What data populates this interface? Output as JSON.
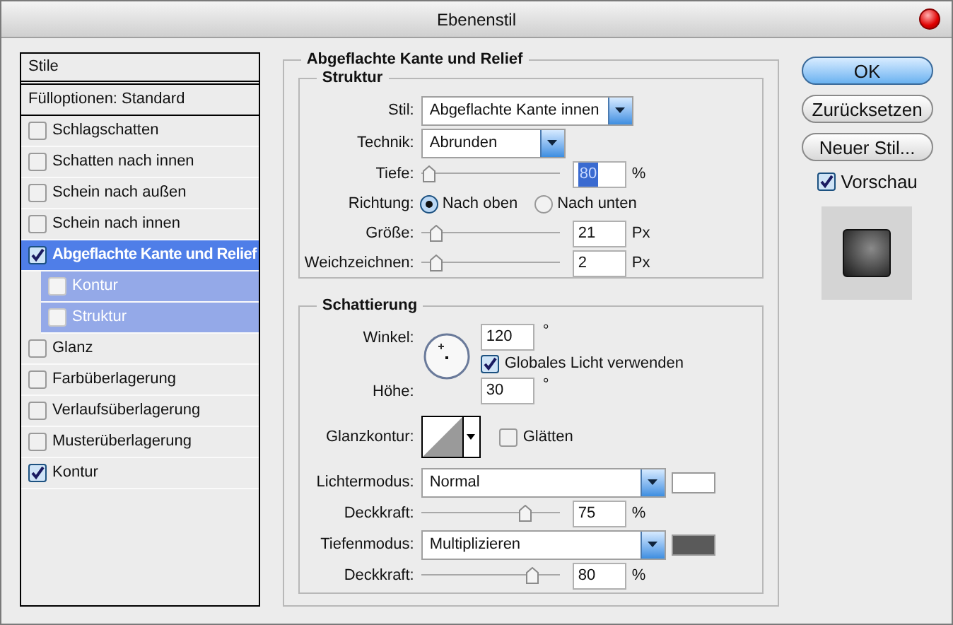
{
  "window": {
    "title": "Ebenenstil"
  },
  "sidebar": {
    "header": "Stile",
    "blending": "Fülloptionen: Standard",
    "items": [
      {
        "label": "Schlagschatten",
        "checked": false,
        "selected": false
      },
      {
        "label": "Schatten nach innen",
        "checked": false,
        "selected": false
      },
      {
        "label": "Schein nach außen",
        "checked": false,
        "selected": false
      },
      {
        "label": "Schein nach innen",
        "checked": false,
        "selected": false
      },
      {
        "label": "Abgeflachte Kante und Relief",
        "checked": true,
        "selected": true,
        "children": [
          {
            "label": "Kontur",
            "checked": false,
            "selected": true
          },
          {
            "label": "Struktur",
            "checked": false,
            "selected": true
          }
        ]
      },
      {
        "label": "Glanz",
        "checked": false,
        "selected": false
      },
      {
        "label": "Farbüberlagerung",
        "checked": false,
        "selected": false
      },
      {
        "label": "Verlaufsüberlagerung",
        "checked": false,
        "selected": false
      },
      {
        "label": "Musterüberlagerung",
        "checked": false,
        "selected": false
      },
      {
        "label": "Kontur",
        "checked": true,
        "selected": false
      }
    ]
  },
  "panel": {
    "title": "Abgeflachte Kante und Relief",
    "struktur": {
      "title": "Struktur",
      "rows": [
        {
          "kind": "select",
          "label": "Stil:",
          "value": "Abgeflachte Kante innen"
        },
        {
          "kind": "select",
          "label": "Technik:",
          "value": "Abrunden"
        },
        {
          "kind": "slider",
          "label": "Tiefe:",
          "level": 0.05,
          "value": "80",
          "unit": "%",
          "text_selected": true
        },
        {
          "kind": "radio",
          "label": "Richtung:",
          "options": [
            {
              "label": "Nach oben",
              "selected": true
            },
            {
              "label": "Nach unten",
              "selected": false
            }
          ]
        },
        {
          "kind": "slider",
          "label": "Größe:",
          "level": 0.1,
          "value": "21",
          "unit": "Px",
          "text_selected": false
        },
        {
          "kind": "slider",
          "label": "Weichzeichnen:",
          "level": 0.1,
          "value": "2",
          "unit": "Px",
          "text_selected": false
        }
      ]
    },
    "schattierung": {
      "title": "Schattierung",
      "angle": {
        "label": "Winkel:",
        "value": "120",
        "unit": "°"
      },
      "global_light": {
        "label": "Globales Licht verwenden",
        "checked": true
      },
      "altitude": {
        "label": "Höhe:",
        "value": "30",
        "unit": "°"
      },
      "gloss": {
        "label": "Glanzkontur:",
        "antialias": {
          "label": "Glätten",
          "checked": false
        }
      },
      "rows": [
        {
          "kind": "select",
          "label": "Lichtermodus:",
          "value": "Normal",
          "color": "#ffffff"
        },
        {
          "kind": "slider",
          "label": "Deckkraft:",
          "level": 0.75,
          "value": "75",
          "unit": "%"
        },
        {
          "kind": "select",
          "label": "Tiefenmodus:",
          "value": "Multiplizieren",
          "color": "#5a5a5a"
        },
        {
          "kind": "slider",
          "label": "Deckkraft:",
          "level": 0.8,
          "value": "80",
          "unit": "%"
        }
      ]
    }
  },
  "buttons": [
    {
      "label": "OK",
      "default": true
    },
    {
      "label": "Zurücksetzen",
      "default": false
    },
    {
      "label": "Neuer Stil...",
      "default": false
    }
  ],
  "preview": {
    "label": "Vorschau",
    "checked": true
  }
}
